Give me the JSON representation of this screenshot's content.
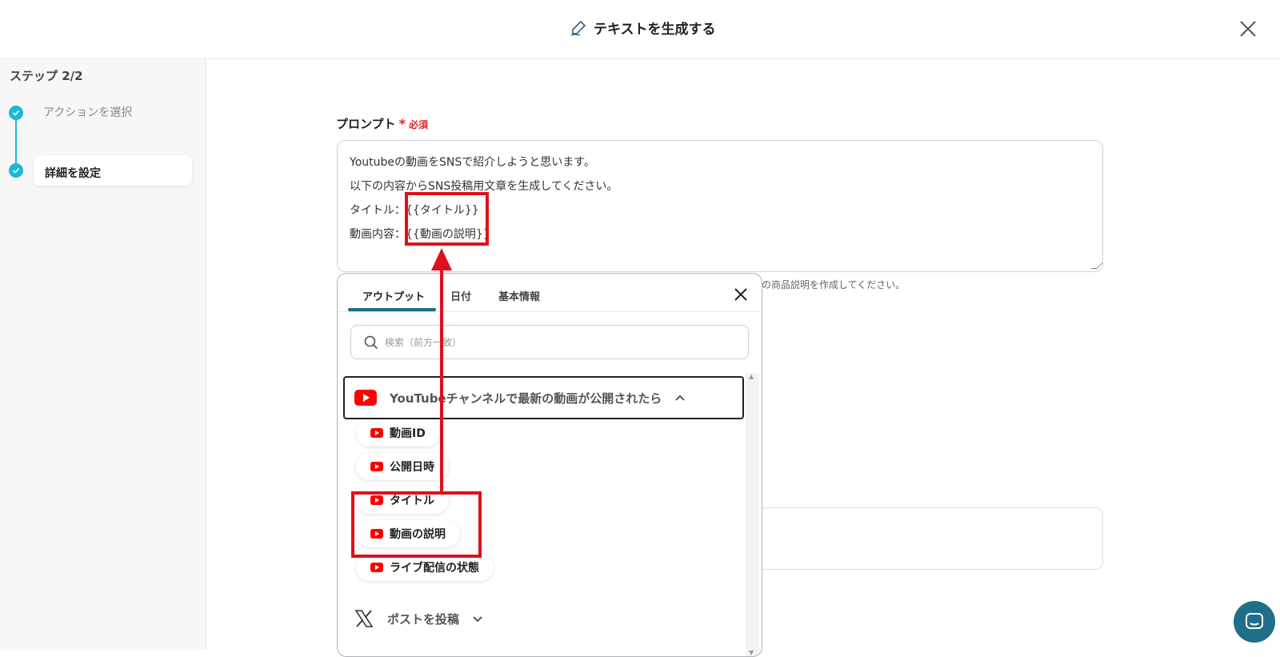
{
  "header": {
    "title": "テキストを生成する",
    "icon": "pen-icon",
    "close_icon": "close-icon"
  },
  "sidebar": {
    "step_label": "ステップ 2/2",
    "items": [
      {
        "label": "アクションを選択",
        "status": "completed"
      },
      {
        "label": "詳細を設定",
        "status": "current"
      }
    ]
  },
  "prompt": {
    "label": "プロンプト",
    "required_mark": "*",
    "required_text": "必須",
    "lines": [
      "Youtubeの動画をSNSで紹介しようと思います。",
      "以下の内容からSNS投稿用文章を生成してください。",
      "タイトル：{{タイトル}}",
      "動画内容：{{動画の説明}}"
    ],
    "hint_partial": "の商品説明を作成してください。"
  },
  "popup": {
    "tabs": [
      "アウトプット",
      "日付",
      "基本情報"
    ],
    "active_tab": "アウトプット",
    "search_placeholder": "検索（前方一致）",
    "groups": [
      {
        "title": "YouTubeチャンネルで最新の動画が公開されたら",
        "icon": "youtube-icon",
        "expanded": true,
        "items": [
          "動画ID",
          "公開日時",
          "タイトル",
          "動画の説明",
          "ライブ配信の状態"
        ]
      },
      {
        "title": "ポストを投稿",
        "icon": "x-icon",
        "expanded": false
      }
    ]
  },
  "colors": {
    "accent": "#1bb8d8",
    "highlight": "#e0101a",
    "youtube": "#ff0000",
    "tab_underline": "#1b6e86"
  }
}
